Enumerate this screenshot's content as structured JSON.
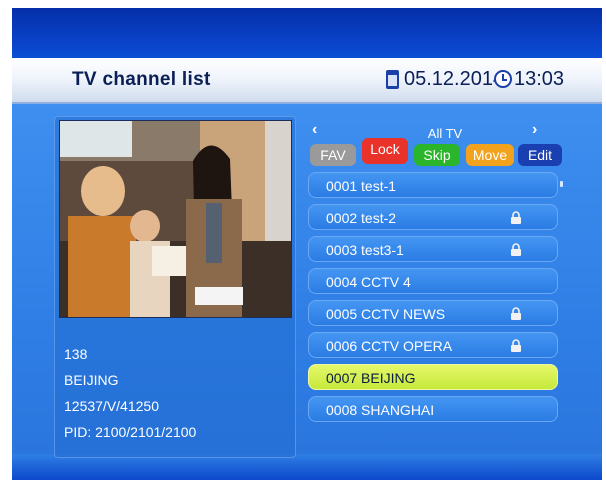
{
  "header": {
    "title": "TV channel list",
    "date": "05.12.2014",
    "time": "13:03"
  },
  "group": {
    "name": "All TV",
    "prev_icon": "chevron-left-icon",
    "next_icon": "chevron-right-icon"
  },
  "buttons": [
    {
      "label": "FAV",
      "color": "#9a9a9a",
      "text_color": "#ffffff"
    },
    {
      "label": "Lock",
      "color": "#e8322a",
      "text_color": "#ffffff"
    },
    {
      "label": "Skip",
      "color": "#2bb52b",
      "text_color": "#ffffff"
    },
    {
      "label": "Move",
      "color": "#f2a21c",
      "text_color": "#ffffff"
    },
    {
      "label": "Edit",
      "color": "#1a3fb0",
      "text_color": "#ffffff"
    }
  ],
  "channels": [
    {
      "label": "0001 test-1",
      "locked": false,
      "selected": false
    },
    {
      "label": "0002 test-2",
      "locked": true,
      "selected": false
    },
    {
      "label": "0003 test3-1",
      "locked": true,
      "selected": false
    },
    {
      "label": "0004 CCTV 4",
      "locked": false,
      "selected": false
    },
    {
      "label": "0005 CCTV NEWS",
      "locked": true,
      "selected": false
    },
    {
      "label": "0006 CCTV OPERA",
      "locked": true,
      "selected": false
    },
    {
      "label": "0007 BEIJING",
      "locked": false,
      "selected": true
    },
    {
      "label": "0008 SHANGHAI",
      "locked": false,
      "selected": false
    }
  ],
  "info": {
    "number": "138",
    "name": "BEIJING",
    "transponder": "12537/V/41250",
    "pid": "PID: 2100/2101/2100"
  },
  "colors": {
    "selected": "#d4f04a",
    "background": "#2f7fe6",
    "header": "#eef3fb"
  }
}
